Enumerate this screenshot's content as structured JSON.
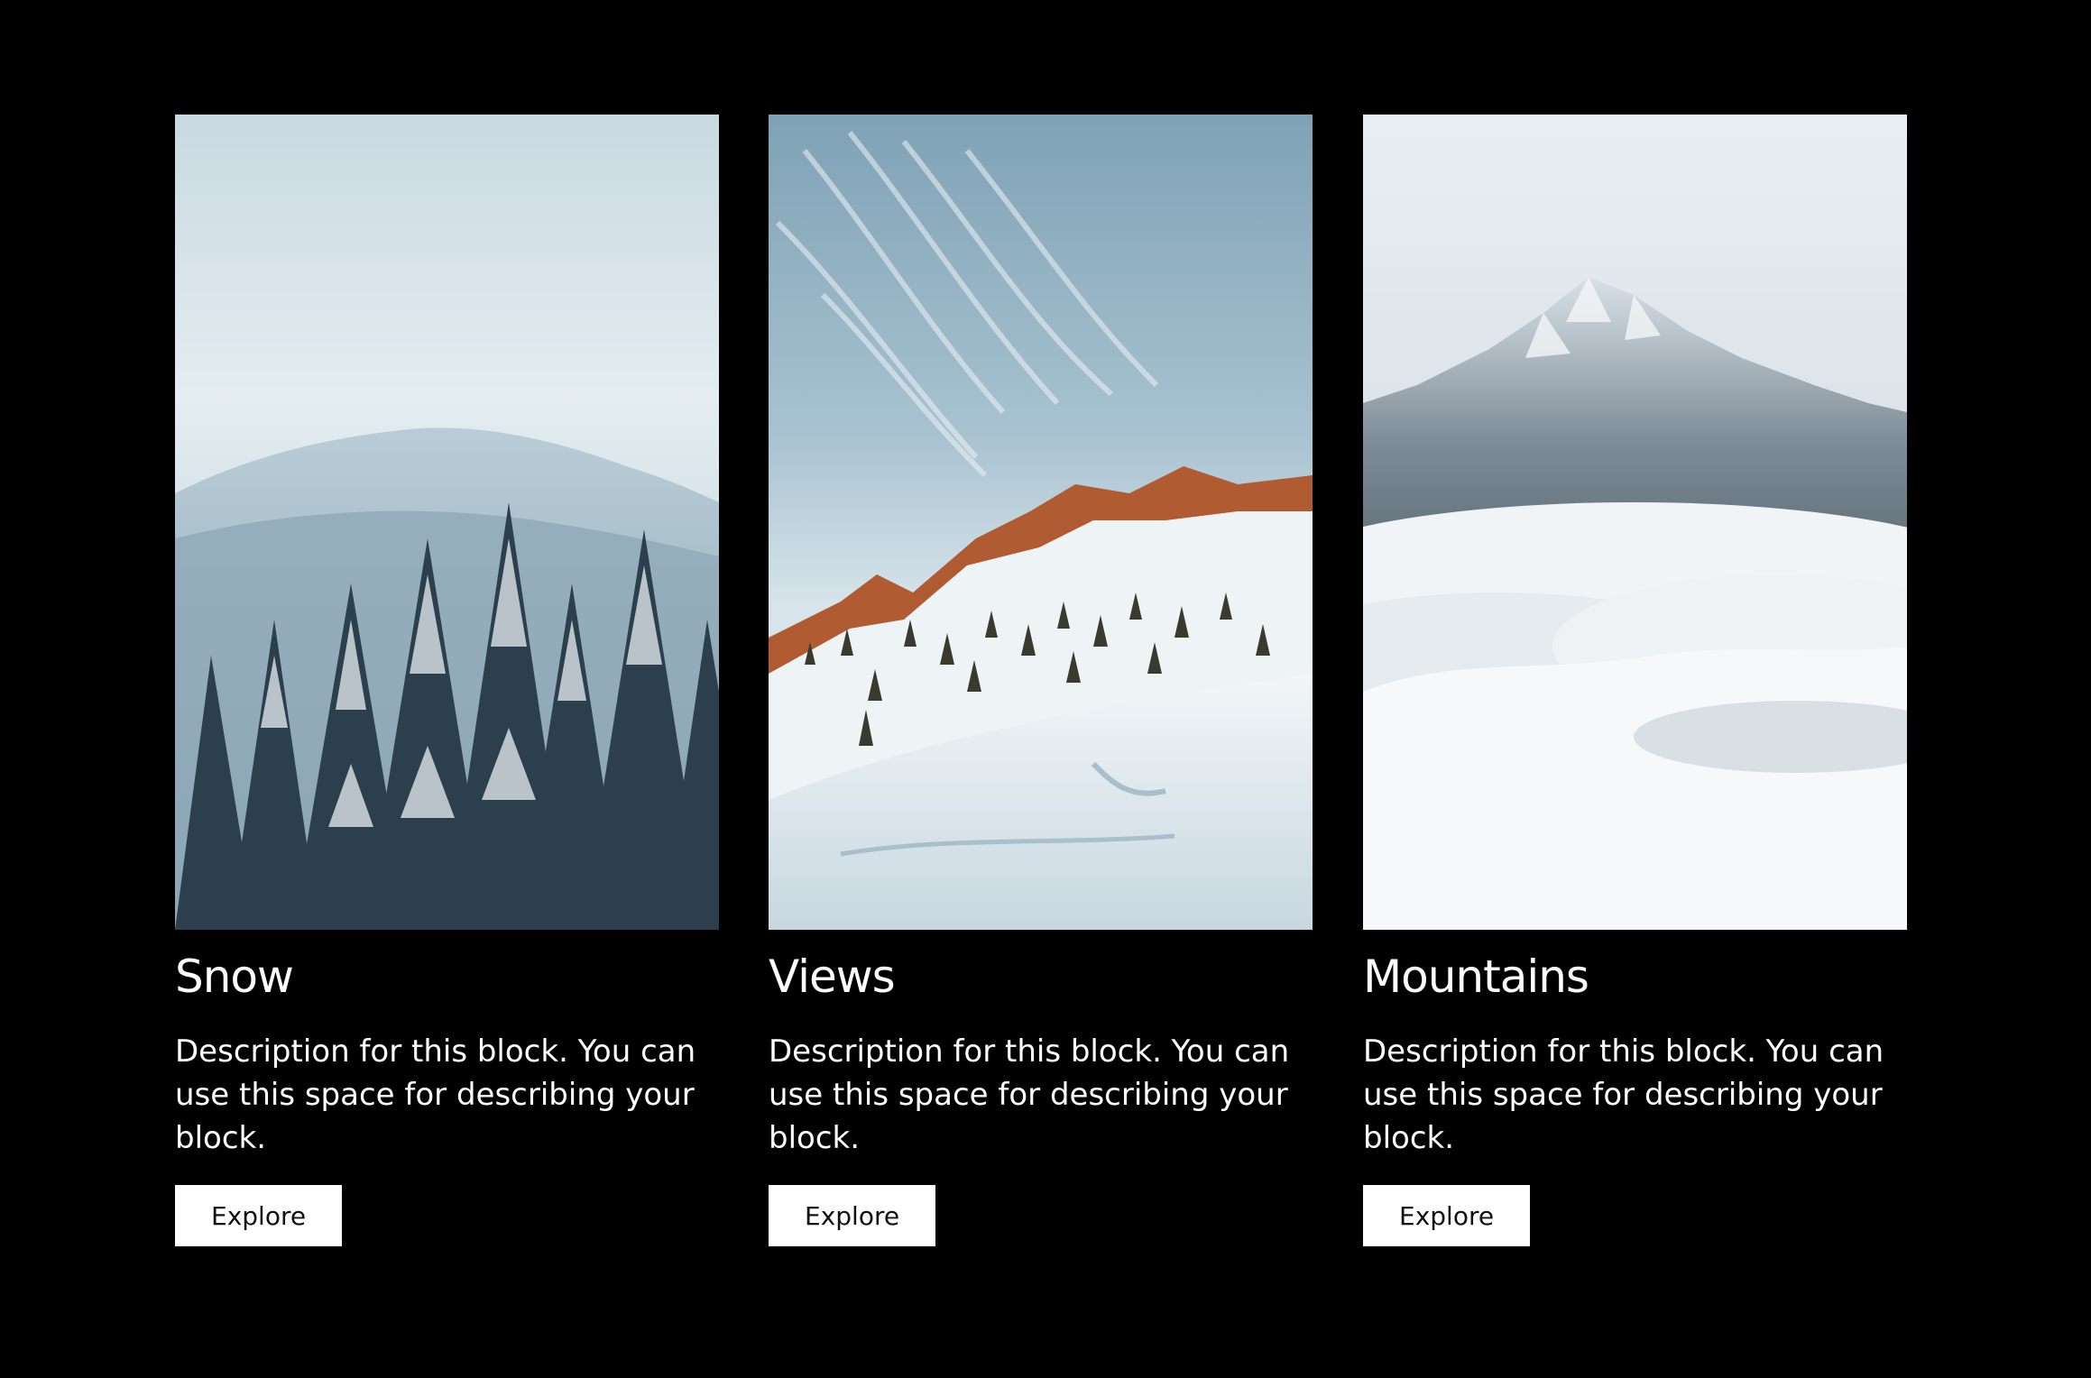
{
  "colors": {
    "background": "#000000",
    "text": "#ffffff",
    "button_bg": "#ffffff",
    "button_text": "#111111"
  },
  "cards": [
    {
      "title": "Snow",
      "description": "Description for this block. You can use this space for describing your block.",
      "button_label": "Explore",
      "image": "snowy-forest-photo"
    },
    {
      "title": "Views",
      "description": "Description for this block. You can use this space for describing your block.",
      "button_label": "Explore",
      "image": "snowy-ridge-photo"
    },
    {
      "title": "Mountains",
      "description": "Description for this block. You can use this space for describing your block.",
      "button_label": "Explore",
      "image": "misty-mountain-photo"
    }
  ]
}
